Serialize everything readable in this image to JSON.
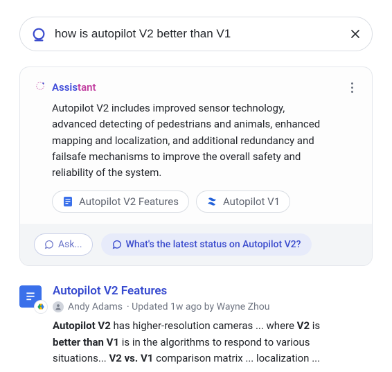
{
  "search": {
    "query": "how is autopilot V2 better than V1"
  },
  "assistant": {
    "title_part1": "Assis",
    "title_part2": "tant",
    "answer": "Autopilot V2 includes improved sensor technology, advanced detecting of pedestrians and animals, enhanced mapping and localization, and additional redundancy and failsafe mechanisms to improve the overall safety and reliability of the system.",
    "refs": [
      {
        "label": "Autopilot V2 Features",
        "icon": "doc"
      },
      {
        "label": "Autopilot V1",
        "icon": "confluence"
      }
    ],
    "ask_label": "Ask...",
    "suggestion": "What's the latest status on Autopilot V2?"
  },
  "result": {
    "title": "Autopilot V2 Features",
    "author": "Andy Adams",
    "meta_rest": " · Updated 1w ago by Wayne Zhou",
    "snippet_html": "<b>Autopilot V2</b> has higher-resolution cameras ... where <b>V2</b> is <b>better than V1</b> is in the algorithms to respond to various situations... <b>V2 vs. V1</b> comparison matrix ... localization ..."
  }
}
